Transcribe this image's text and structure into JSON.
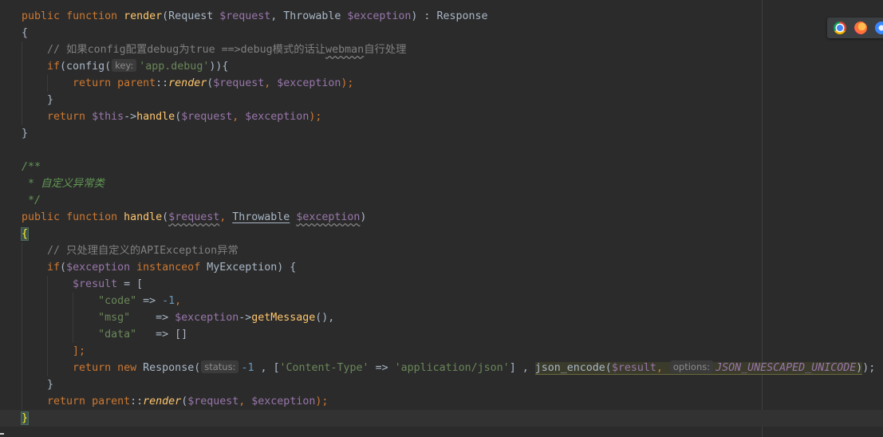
{
  "editor": {
    "lines": {
      "l1": {
        "kw_public": "public",
        "kw_function": "function",
        "name": "render",
        "open": "(Request ",
        "var1": "$request",
        "comma": ", Throwable ",
        "var2": "$exception",
        "close": ") : Response"
      },
      "l2": {
        "text": "{"
      },
      "l3": {
        "text": "// 如果config配置debug为true ==>debug模式的话让",
        "wavy": "webman",
        "tail": "自行处理"
      },
      "l4": {
        "kw": "if",
        "pre": "(config(",
        "hint": "key:",
        "str": "'app.debug'",
        "post": ")){"
      },
      "l5": {
        "kw_return": "return",
        "kw_parent": "parent",
        "sep": "::",
        "call": "render",
        "open": "(",
        "var1": "$request",
        "comma": ", ",
        "var2": "$exception",
        "close": ");"
      },
      "l6": {
        "text": "}"
      },
      "l7": {
        "kw_return": "return",
        "var_this": "$this",
        "arrow": "->",
        "call": "handle",
        "open": "(",
        "var1": "$request",
        "comma": ", ",
        "var2": "$exception",
        "close": ");"
      },
      "l8": {
        "text": "}"
      },
      "l10": {
        "text": "/**"
      },
      "l11": {
        "text": " * 自定义异常类"
      },
      "l12": {
        "text": " */"
      },
      "l13": {
        "kw_public": "public",
        "kw_function": "function",
        "name": "handle",
        "open": "(",
        "var1": "$request",
        "comma": ", ",
        "type": "Throwable",
        "space": " ",
        "var2": "$exception",
        "close": ")"
      },
      "l14": {
        "text": "{"
      },
      "l15": {
        "text": "// 只处理自定义的APIException异常"
      },
      "l16": {
        "kw_if": "if",
        "open": "(",
        "var": "$exception",
        "kw_instanceof": "instanceof",
        "cls": "MyException",
        "close": ") {"
      },
      "l17": {
        "var": "$result",
        "rest": " = ["
      },
      "l18": {
        "key": "\"code\"",
        "arrow": " => ",
        "num": "-1",
        "comma": ","
      },
      "l19": {
        "key": "\"msg\"",
        "arrow": "    => ",
        "var": "$exception",
        "op": "->",
        "call": "getMessage",
        "rest": "(),"
      },
      "l20": {
        "key": "\"data\"",
        "arrow": "   => []"
      },
      "l21": {
        "text": "];"
      },
      "l22": {
        "kw_return": "return",
        "kw_new": "new",
        "cls": "Response(",
        "hint1": "status:",
        "num": "-1",
        "mid": " , [",
        "s1": "'Content-Type'",
        "arrow": " => ",
        "s2": "'application/json'",
        "mid2": "] , ",
        "call": "json_encode(",
        "var": "$result",
        "comma": ", ",
        "hint2": "options:",
        "const": "JSON_UNESCAPED_UNICODE",
        "close": ")",
        "end": ");"
      },
      "l23": {
        "text": "}"
      },
      "l24": {
        "kw_return": "return",
        "kw_parent": "parent",
        "sep": "::",
        "call": "render",
        "open": "(",
        "var1": "$request",
        "comma": ", ",
        "var2": "$exception",
        "close": ");"
      },
      "l25": {
        "text": "}"
      }
    }
  },
  "browser_icons": [
    "chrome-icon",
    "firefox-icon",
    "safari-icon"
  ],
  "colors": {
    "background": "#2b2b2b",
    "keyword": "#cc7832",
    "function": "#ffc66d",
    "variable": "#9876aa",
    "string": "#6a8759",
    "number": "#6897bb",
    "comment": "#808080",
    "doc_comment": "#629755"
  }
}
